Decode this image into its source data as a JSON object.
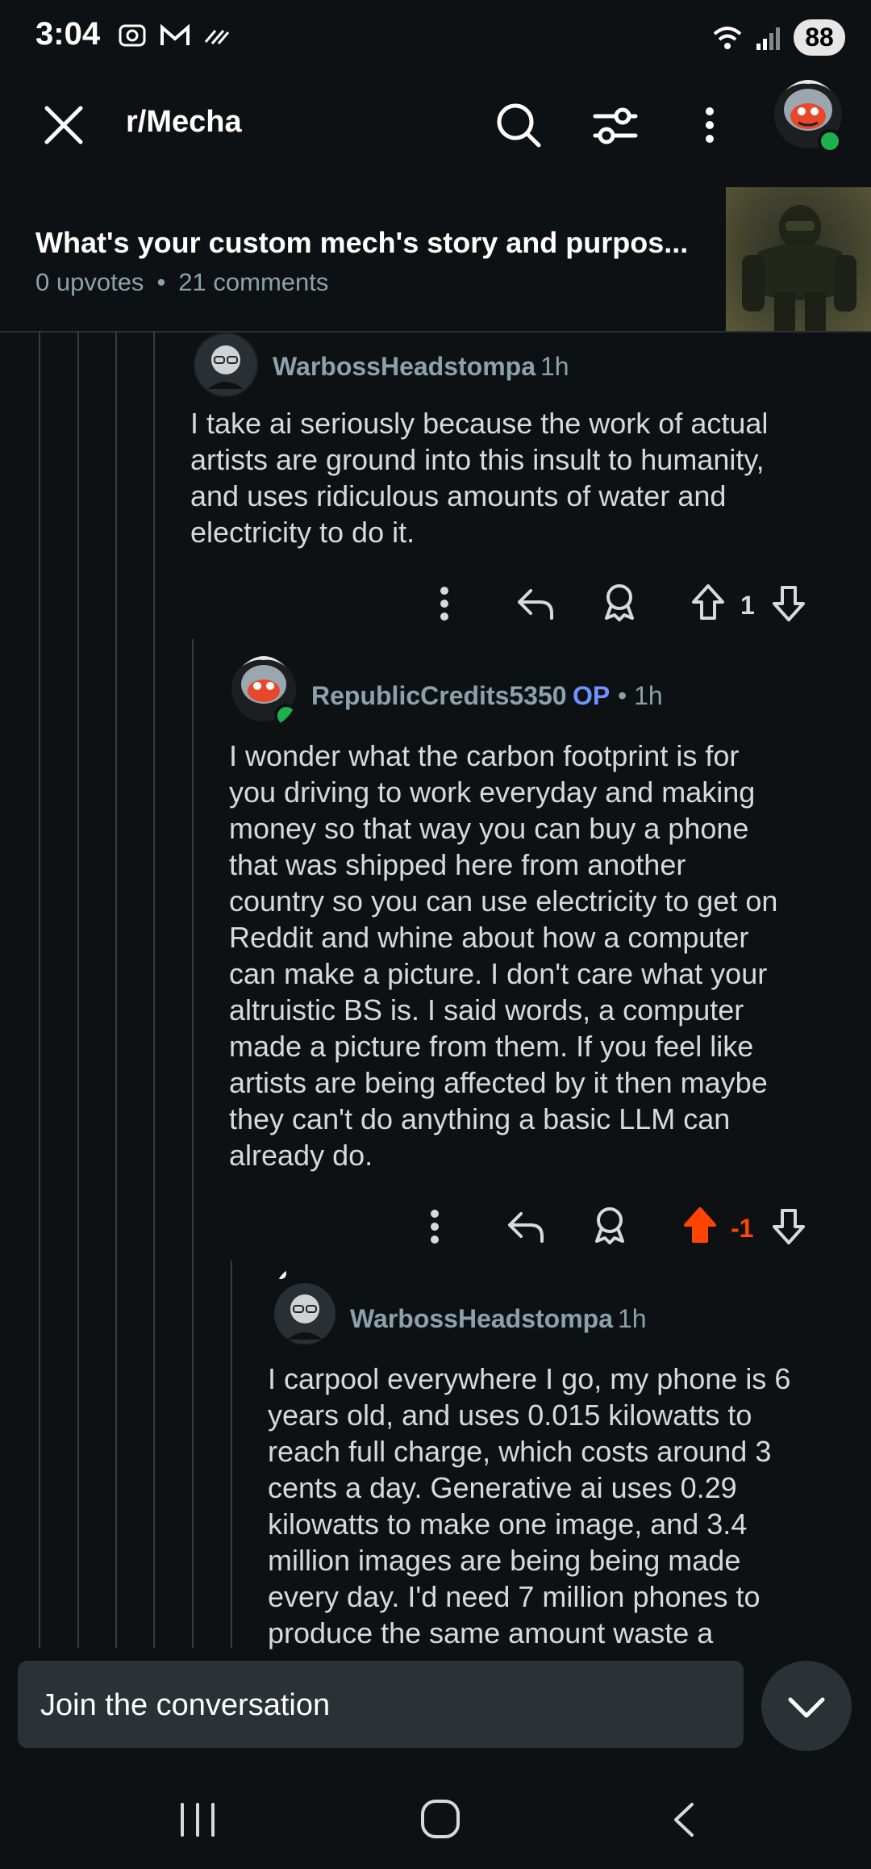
{
  "status_bar": {
    "time": "3:04",
    "battery": "88"
  },
  "header": {
    "subreddit": "r/Mecha"
  },
  "post": {
    "title": "What's your custom mech's story and purpos...",
    "upvotes": "0 upvotes",
    "separator": "•",
    "comments": "21 comments"
  },
  "comments": [
    {
      "author": "WarbossHeadstompa",
      "time": "1h",
      "lines": [
        "I take ai seriously because the work of actual",
        "artists are ground into this insult to humanity,",
        "and uses ridiculous amounts of water and",
        "electricity to do it."
      ],
      "score": "1"
    },
    {
      "author": "RepublicCredits5350",
      "op_badge": "OP",
      "time": "• 1h",
      "lines": [
        "I wonder what the carbon footprint is for",
        "you driving to work everyday and making",
        "money so that way you can buy a phone",
        "that was shipped here from another",
        "country so you can use electricity to get on",
        "Reddit and whine about how a computer",
        "can make a picture. I don't care what your",
        "altruistic BS is. I said words, a computer",
        "made a picture from them. If you feel like",
        "artists are being affected by it then maybe",
        "they can't do anything a basic LLM can",
        "already do."
      ],
      "score": "-1"
    },
    {
      "author": "WarbossHeadstompa",
      "time": "1h",
      "lines": [
        "I carpool everywhere I go, my phone is 6",
        "years old, and uses 0.015 kilowatts to",
        "reach full charge, which costs around 3",
        "cents a day. Generative ai uses 0.29",
        "kilowatts to make one image, and 3.4",
        "million images are being being made",
        "every day. I'd need 7 million phones to",
        "produce the same amount waste a"
      ]
    }
  ],
  "composer": {
    "placeholder": "Join the conversation"
  },
  "colors": {
    "background": "#0e1113",
    "accent_op": "#6f92ff",
    "downvoted": "#ff4500",
    "online": "#1bb24b"
  }
}
